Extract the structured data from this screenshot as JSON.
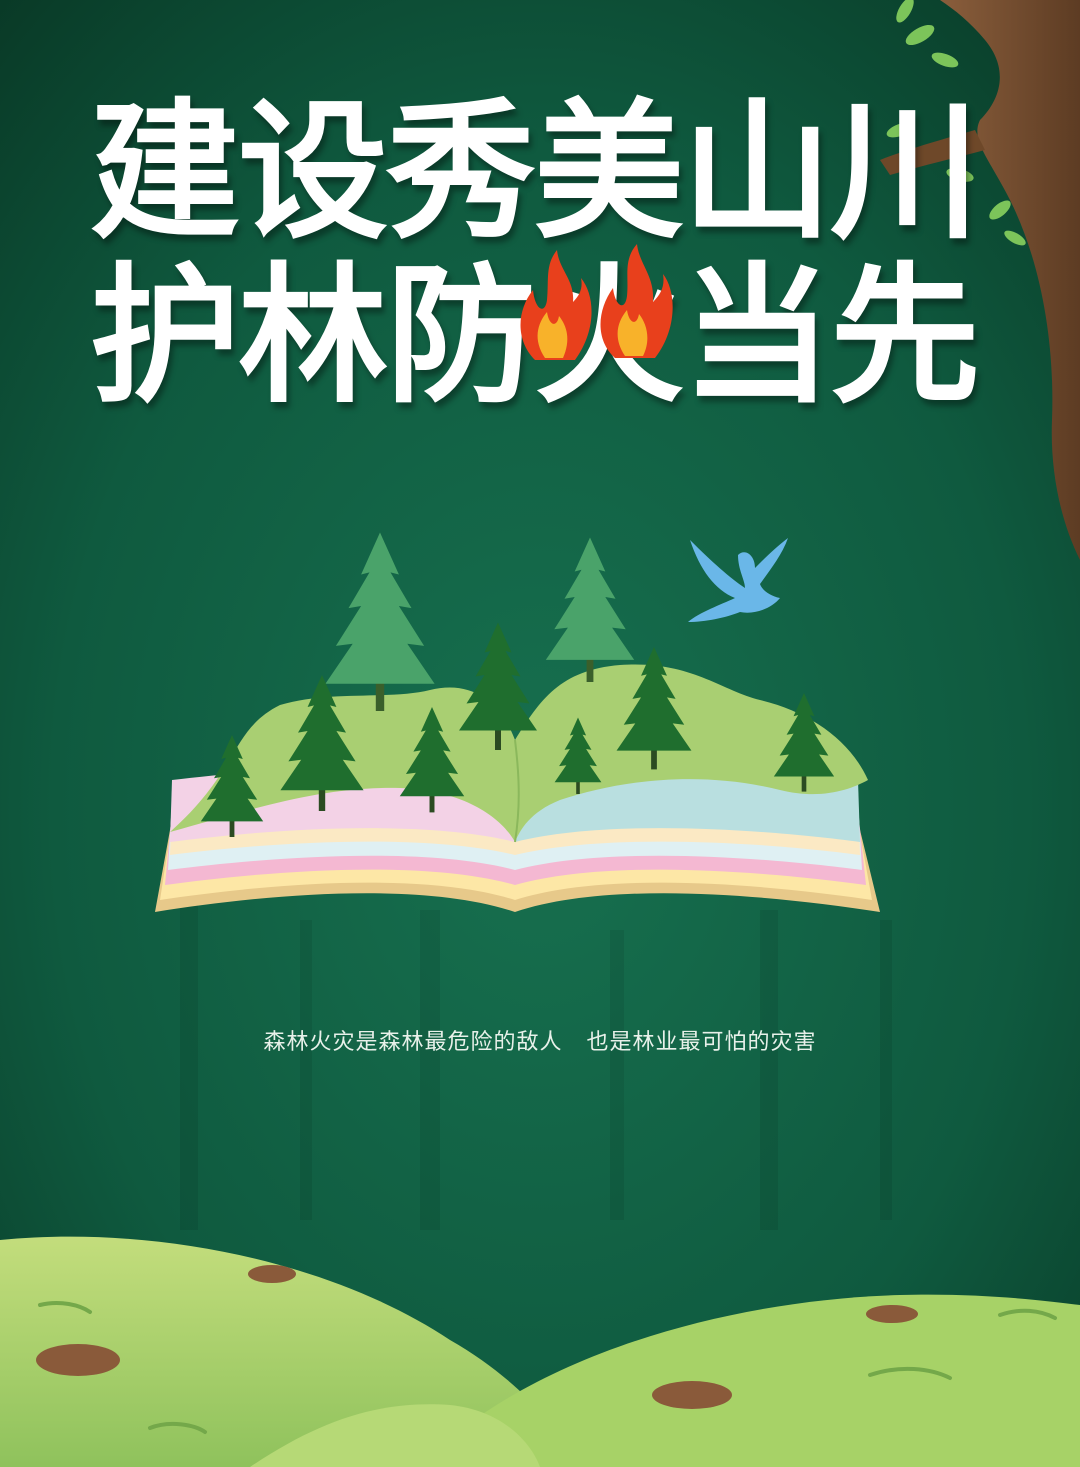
{
  "headline": {
    "line1": "建设秀美山川",
    "line2": "护林防火当先"
  },
  "slogan": "森林火灾是森林最危险的敌人   也是林业最可怕的灾害",
  "colors": {
    "background": "#0d4c37",
    "headline_text": "#ffffff",
    "tree_dark": "#1f6e2e",
    "tree_light": "#4aa36a",
    "meadow": "#a9cf72",
    "flame_outer": "#e8401c",
    "flame_inner": "#f8b22a",
    "dove": "#6ab7e8",
    "trunk": "#7a5132"
  },
  "illustration": {
    "book_page_stripes": [
      "#b9dfe0",
      "#f3d2e6",
      "#fbe9c4",
      "#dff0f3",
      "#f4b8d2",
      "#fde7a6"
    ],
    "icons": [
      "tree-trunk-icon",
      "flame-icon",
      "dove-icon",
      "open-book-icon",
      "pine-tree-icon",
      "hill-icon",
      "rock-icon"
    ]
  }
}
